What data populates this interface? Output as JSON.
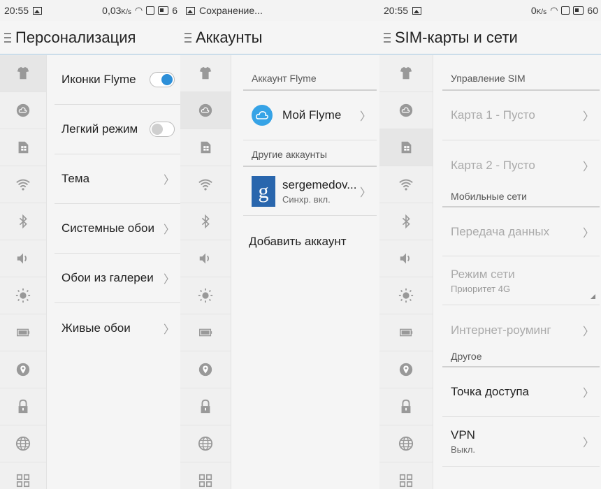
{
  "panels": [
    {
      "status": {
        "time": "20:55",
        "right_text": "0,03",
        "right_unit": "K/s",
        "trail": "6"
      },
      "title": "Персонализация",
      "selected_sidebar": 0,
      "rows": [
        {
          "label": "Иконки Flyme",
          "control": "toggle",
          "state": "on"
        },
        {
          "label": "Легкий режим",
          "control": "toggle",
          "state": "off"
        },
        {
          "label": "Тема",
          "control": "chevron"
        },
        {
          "label": "Системные обои",
          "control": "chevron"
        },
        {
          "label": "Обои из галереи",
          "control": "chevron"
        },
        {
          "label": "Живые обои",
          "control": "chevron"
        }
      ]
    },
    {
      "status": {
        "saving": "Сохранение..."
      },
      "title": "Аккаунты",
      "selected_sidebar": 1,
      "section_flyme": "Аккаунт Flyme",
      "flyme_account": "Мой Flyme",
      "section_other": "Другие аккаунты",
      "google_account": {
        "name": "sergemedov...",
        "sync": "Синхр. вкл.",
        "icon_letter": "g"
      },
      "add_account": "Добавить аккаунт"
    },
    {
      "status": {
        "time": "20:55",
        "right_text": "0",
        "right_unit": "K/s",
        "battery": "60"
      },
      "title": "SIM-карты и сети",
      "selected_sidebar": 2,
      "sec_sim": "Управление SIM",
      "sim1": "Карта 1 - Пусто",
      "sim2": "Карта 2 - Пусто",
      "sec_mobile": "Мобильные сети",
      "data_transfer": "Передача данных",
      "network_mode": "Режим сети",
      "network_mode_value": "Приоритет 4G",
      "roaming": "Интернет-роуминг",
      "sec_other": "Другое",
      "hotspot": "Точка доступа",
      "vpn": "VPN",
      "vpn_value": "Выкл."
    }
  ],
  "sidebar_icons": [
    "personalization-icon",
    "accounts-icon",
    "sim-icon",
    "wifi-icon",
    "bluetooth-icon",
    "sound-icon",
    "brightness-icon",
    "battery-icon",
    "location-icon",
    "lock-icon",
    "globe-icon",
    "apps-icon"
  ],
  "colors": {
    "accent": "#2d8fd8",
    "icon_gray": "#9a9a9a"
  }
}
